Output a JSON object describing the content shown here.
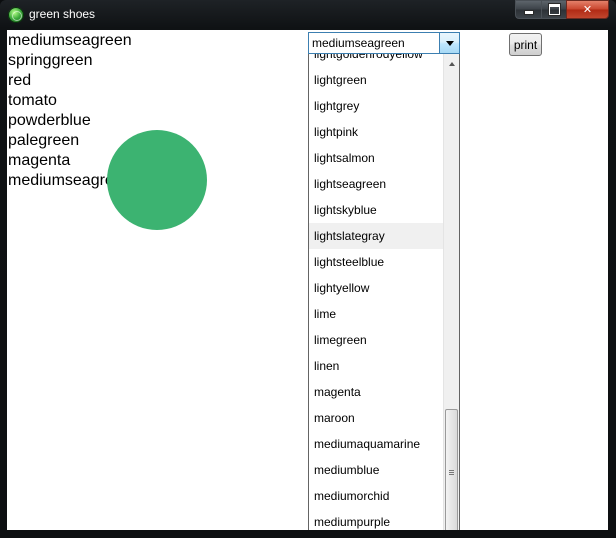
{
  "window": {
    "title": "green shoes",
    "controls": {
      "minimize": "",
      "maximize": "",
      "close": "✕"
    }
  },
  "colors": {
    "circle_fill": "#3cb371",
    "highlight_row": "#f0f0f0"
  },
  "color_history": [
    "mediumseagreen",
    "springgreen",
    "red",
    "tomato",
    "powderblue",
    "palegreen",
    "magenta",
    "mediumseagreen"
  ],
  "combo": {
    "selected": "mediumseagreen",
    "list_items": [
      "lightgoldenrodyellow",
      "lightgreen",
      "lightgrey",
      "lightpink",
      "lightsalmon",
      "lightseagreen",
      "lightskyblue",
      "lightslategray",
      "lightsteelblue",
      "lightyellow",
      "lime",
      "limegreen",
      "linen",
      "magenta",
      "maroon",
      "mediumaquamarine",
      "mediumblue",
      "mediumorchid",
      "mediumpurple"
    ],
    "hovered_item": "lightslategray"
  },
  "print_button": {
    "label": "print"
  }
}
